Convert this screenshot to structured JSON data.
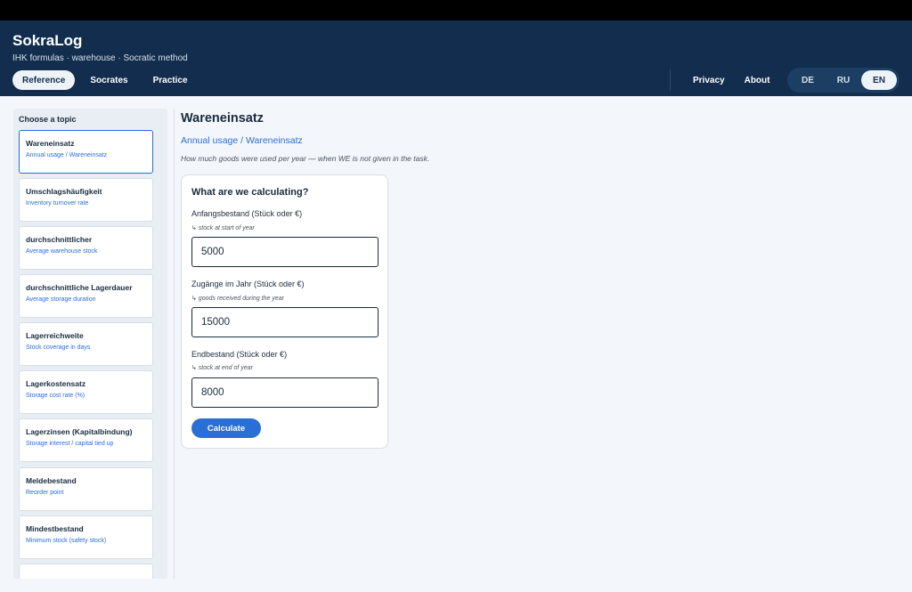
{
  "header": {
    "title": "SokraLog",
    "subtitle": "IHK formulas · warehouse · Socratic method",
    "nav": [
      "Reference",
      "Socrates",
      "Practice"
    ],
    "links": [
      "Privacy",
      "About"
    ],
    "languages": [
      "DE",
      "RU",
      "EN"
    ],
    "active_nav": "Reference",
    "active_language": "EN"
  },
  "sidebar": {
    "title": "Choose a topic",
    "topics": [
      {
        "name": "Wareneinsatz",
        "sub": "Annual usage / Wareneinsatz"
      },
      {
        "name": "Umschlagshäufigkeit",
        "sub": "Inventory turnover rate"
      },
      {
        "name": "durchschnittlicher",
        "sub": "Average warehouse stock"
      },
      {
        "name": "durchschnittliche Lagerdauer",
        "sub": "Average storage duration"
      },
      {
        "name": "Lagerreichweite",
        "sub": "Stock coverage in days"
      },
      {
        "name": "Lagerkostensatz",
        "sub": "Storage cost rate (%)"
      },
      {
        "name": "Lagerzinsen (Kapitalbindung)",
        "sub": "Storage interest / capital tied up"
      },
      {
        "name": "Meldebestand",
        "sub": "Reorder point"
      },
      {
        "name": "Mindestbestand",
        "sub": "Minimum stock (safety stock)"
      }
    ]
  },
  "main": {
    "title": "Wareneinsatz",
    "subtitle": "Annual usage / Wareneinsatz",
    "description": "How much goods were used per year — when WE is not given in the task.",
    "card": {
      "title": "What are we calculating?",
      "fields": [
        {
          "label": "Anfangsbestand (Stück oder €)",
          "hint": "↳ stock at start of year",
          "value": "5000"
        },
        {
          "label": "Zugänge im Jahr (Stück oder €)",
          "hint": "↳ goods received during the year",
          "value": "15000"
        },
        {
          "label": "Endbestand (Stück oder €)",
          "hint": "↳ stock at end of year",
          "value": "8000"
        }
      ],
      "button": "Calculate"
    }
  },
  "colors": {
    "header_bg": "#122d4d",
    "accent": "#2a6fd6",
    "page_bg": "#f3f6fa"
  }
}
